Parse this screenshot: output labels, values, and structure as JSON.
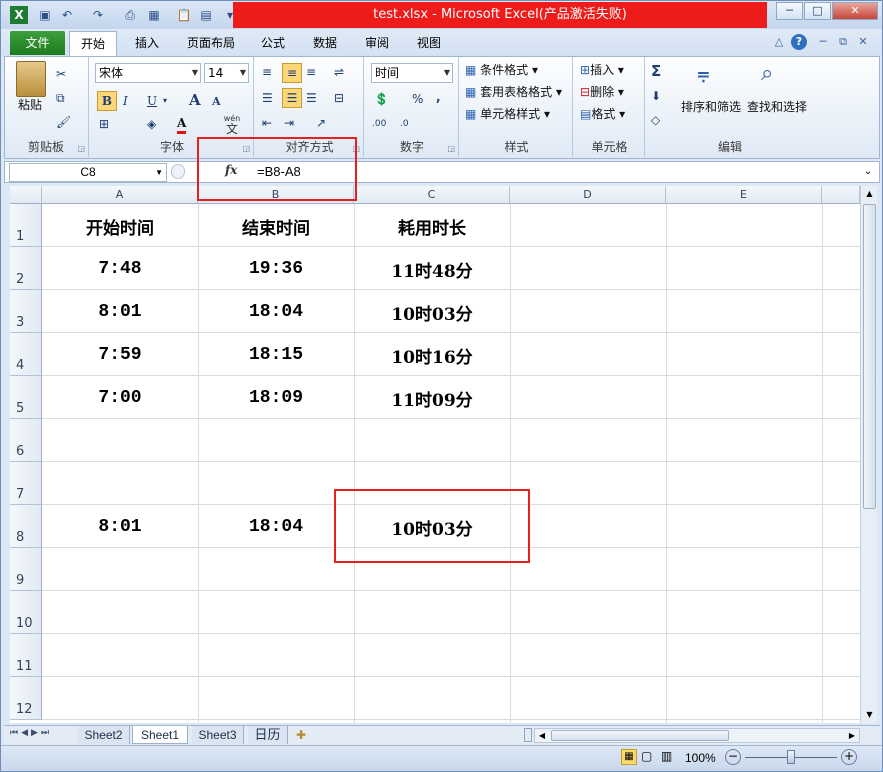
{
  "window": {
    "title": "test.xlsx - Microsoft Excel(产品激活失败)",
    "min": "─",
    "max": "□",
    "close": "✕"
  },
  "quick_access": [
    "save-icon",
    "undo-icon",
    "redo-icon",
    "print-preview-icon",
    "table-icon",
    "paste-icon",
    "camera-icon",
    "customize-icon"
  ],
  "tabs": [
    "文件",
    "开始",
    "插入",
    "页面布局",
    "公式",
    "数据",
    "审阅",
    "视图"
  ],
  "ribbon": {
    "clipboard": {
      "label": "剪贴板",
      "paste": "粘贴"
    },
    "font": {
      "label": "字体",
      "name": "宋体",
      "size": "14",
      "bold": "B",
      "italic": "I",
      "underline": "U",
      "grow": "A",
      "shrink": "A",
      "font_color": "A",
      "wen": "wén",
      "wen_char": "文"
    },
    "alignment": {
      "label": "对齐方式"
    },
    "number": {
      "label": "数字",
      "format": "时间",
      "percent": "%",
      "comma": ",",
      "inc_decimal": ".00",
      "dec_decimal": ".0"
    },
    "styles": {
      "label": "样式",
      "conditional": "条件格式",
      "table": "套用表格格式",
      "cell": "单元格样式"
    },
    "cells": {
      "label": "单元格",
      "insert": "插入",
      "delete": "删除",
      "format": "格式"
    },
    "editing": {
      "label": "编辑",
      "sum": "Σ",
      "sort": "排序和筛选",
      "find": "查找和选择"
    }
  },
  "formula_bar": {
    "name_box": "C8",
    "fx": "fx",
    "formula": "=B8-A8"
  },
  "columns": [
    "A",
    "B",
    "C",
    "D",
    "E"
  ],
  "rows": [
    "1",
    "2",
    "3",
    "4",
    "5",
    "6",
    "7",
    "8",
    "9",
    "10",
    "11",
    "12"
  ],
  "cells": {
    "A1": "开始时间",
    "B1": "结束时间",
    "C1": "耗用时长",
    "A2": "7:48",
    "B2": "19:36",
    "C2": "11时48分",
    "A3": "8:01",
    "B3": "18:04",
    "C3": "10时03分",
    "A4": "7:59",
    "B4": "18:15",
    "C4": "10时16分",
    "A5": "7:00",
    "B5": "18:09",
    "C5": "11时09分",
    "A8": "8:01",
    "B8": "18:04",
    "C8": "10时03分"
  },
  "sheets": [
    "Sheet2",
    "Sheet1",
    "Sheet3",
    "日历"
  ],
  "active_sheet": "Sheet1",
  "status": {
    "zoom": "100%"
  },
  "colors": {
    "highlight_box": "#e62020",
    "title_bar": "#ee1b1b",
    "file_tab": "#2a8a2a"
  }
}
